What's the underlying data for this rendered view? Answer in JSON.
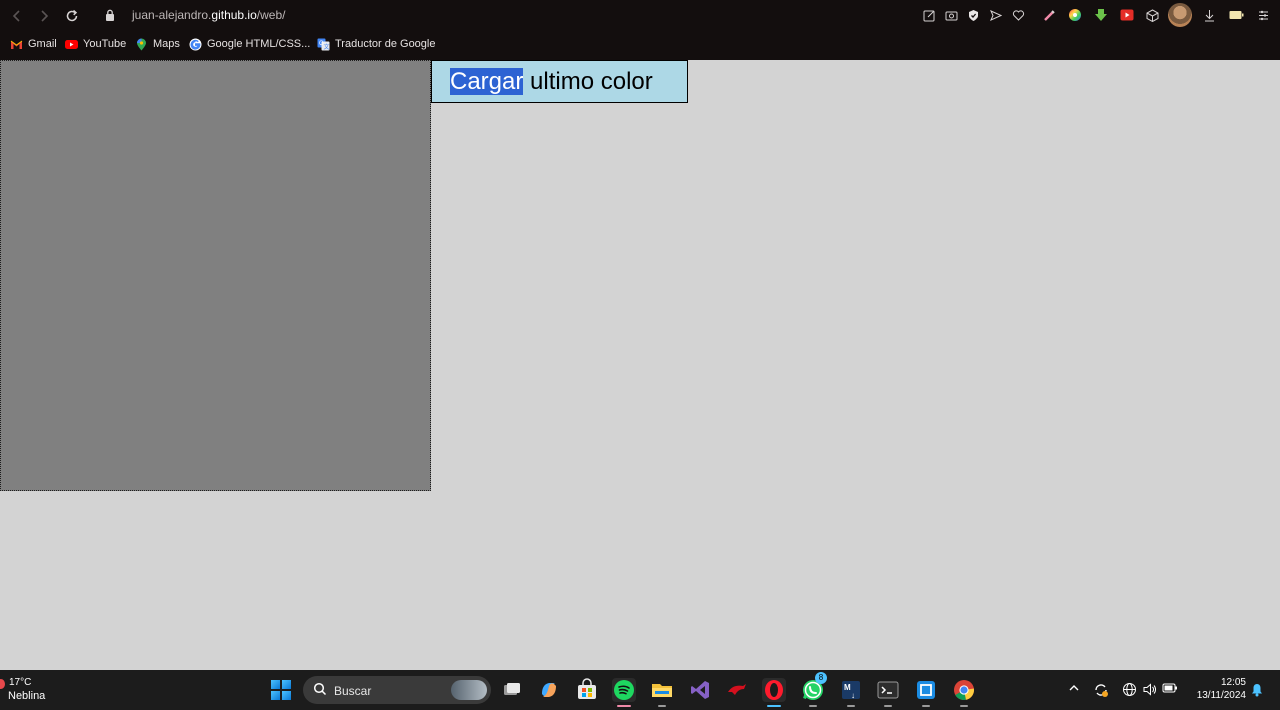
{
  "browser": {
    "url_prefix": "juan-alejandro.",
    "url_host": "github.io",
    "url_path": "/web/",
    "bookmarks": [
      {
        "label": "Gmail"
      },
      {
        "label": "YouTube"
      },
      {
        "label": "Maps"
      },
      {
        "label": "Google HTML/CSS..."
      },
      {
        "label": "Traductor de Google"
      }
    ]
  },
  "page": {
    "color_box_color": "#808080",
    "button_label_selected": "Cargar",
    "button_label_rest": " ultimo color",
    "button_color": "#add8e6"
  },
  "taskbar": {
    "weather_temp": "17°C",
    "weather_condition": "Neblina",
    "search_placeholder": "Buscar",
    "whatsapp_badge": "8",
    "time": "12:05",
    "date": "13/11/2024"
  }
}
